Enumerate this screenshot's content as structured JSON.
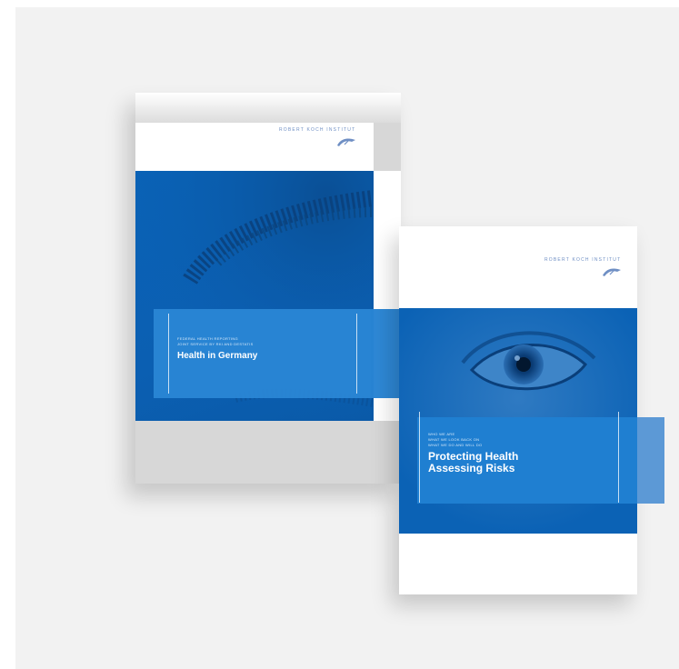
{
  "brochure_left": {
    "logo": "ROBERT KOCH INSTITUT",
    "subtitle_lines": [
      "FEDERAL HEALTH REPORTING",
      "JOINT SERVICE BY RKI AND DESTATIS"
    ],
    "title": "Health in Germany",
    "colors": {
      "blue": "#0a62b6",
      "band": "#2a86d5"
    }
  },
  "brochure_right": {
    "logo": "ROBERT KOCH INSTITUT",
    "subtitle_lines": [
      "WHO WE ARE",
      "WHAT WE LOOK BACK ON",
      "WHAT WE DO AND WILL DO"
    ],
    "title_lines": [
      "Protecting Health",
      "Assessing Risks"
    ],
    "colors": {
      "blue": "#0b62b5",
      "band": "#1f7fd1"
    }
  }
}
